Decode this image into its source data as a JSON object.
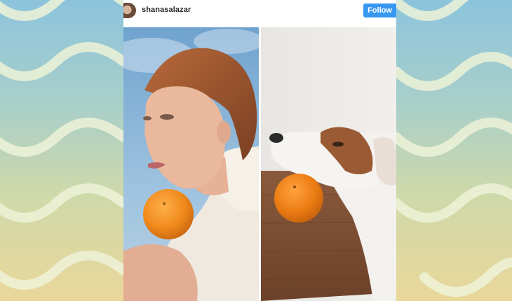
{
  "post": {
    "username": "shanasalazar",
    "follow_label": "Follow"
  },
  "colors": {
    "follow_button": "#3897f0",
    "username_text": "#262626",
    "wave_stroke": "#eef3d8",
    "orange": "#f2891c"
  },
  "icons": {
    "avatar": "profile-avatar"
  },
  "photos": [
    {
      "subject": "woman-with-orange-under-chin"
    },
    {
      "subject": "dog-with-orange-under-chin"
    }
  ]
}
